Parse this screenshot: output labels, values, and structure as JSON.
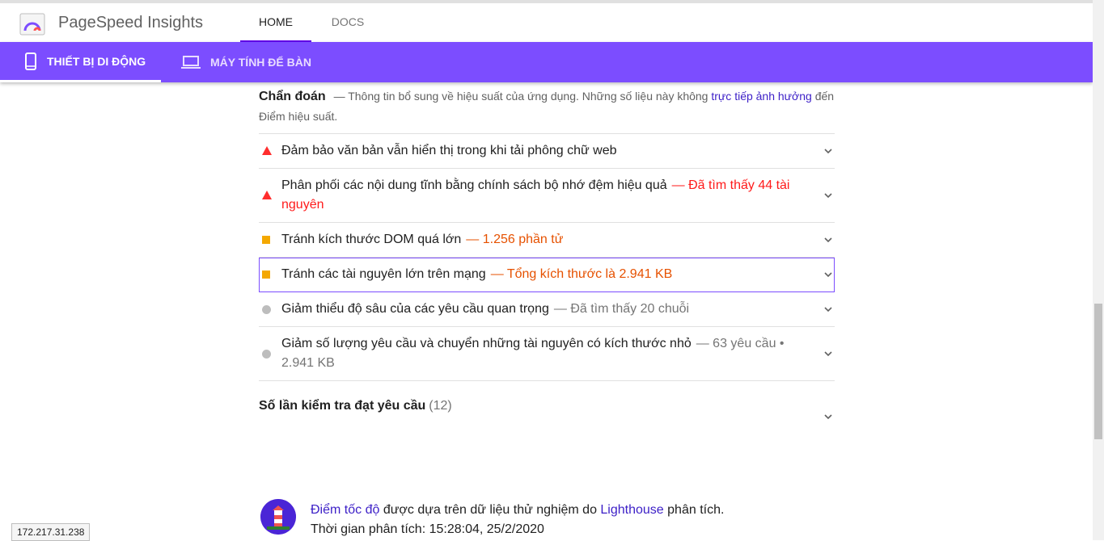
{
  "header": {
    "app_title": "PageSpeed Insights",
    "tabs": [
      {
        "label": "HOME",
        "active": true
      },
      {
        "label": "DOCS",
        "active": false
      }
    ]
  },
  "device_tabs": [
    {
      "label": "THIẾT BỊ DI ĐỘNG",
      "icon": "phone-icon",
      "active": true
    },
    {
      "label": "MÁY TÍNH ĐỂ BÀN",
      "icon": "laptop-icon",
      "active": false
    }
  ],
  "diagnostics": {
    "title": "Chẩn đoán",
    "desc_prefix": "— Thông tin bổ sung về hiệu suất của ứng dụng. Những số liệu này không ",
    "desc_link": "trực tiếp ảnh hưởng",
    "desc_suffix": " đến Điểm hiệu suất.",
    "audits": [
      {
        "severity": "fail",
        "title": "Đảm bảo văn bản vẫn hiển thị trong khi tải phông chữ web",
        "detail": ""
      },
      {
        "severity": "fail",
        "title": "Phân phối các nội dung tĩnh bằng chính sách bộ nhớ đệm hiệu quả",
        "detail": "— Đã tìm thấy 44 tài nguyên"
      },
      {
        "severity": "warn",
        "title": "Tránh kích thước DOM quá lớn",
        "detail": "— 1.256 phần tử"
      },
      {
        "severity": "warn",
        "title": "Tránh các tài nguyên lớn trên mạng",
        "detail": "— Tổng kích thước là 2.941 KB"
      },
      {
        "severity": "info",
        "title": "Giảm thiểu độ sâu của các yêu cầu quan trọng",
        "detail": "— Đã tìm thấy 20 chuỗi"
      },
      {
        "severity": "info",
        "title": "Giảm số lượng yêu cầu và chuyển những tài nguyên có kích thước nhỏ",
        "detail": "— 63 yêu cầu • 2.941 KB"
      }
    ]
  },
  "passed": {
    "title": "Số lần kiểm tra đạt yêu cầu",
    "count": "(12)"
  },
  "footer": {
    "link1": "Điểm tốc độ",
    "text1": " được dựa trên dữ liệu thử nghiệm do ",
    "link2": "Lighthouse",
    "text2": " phân tích.",
    "time_line": "Thời gian phân tích: 15:28:04, 25/2/2020"
  },
  "status_tooltip": "172.217.31.238",
  "colors": {
    "accent": "#7c4dff",
    "fail": "#ff2d2d",
    "warn": "#f4a800",
    "info": "#bdbdbd"
  }
}
